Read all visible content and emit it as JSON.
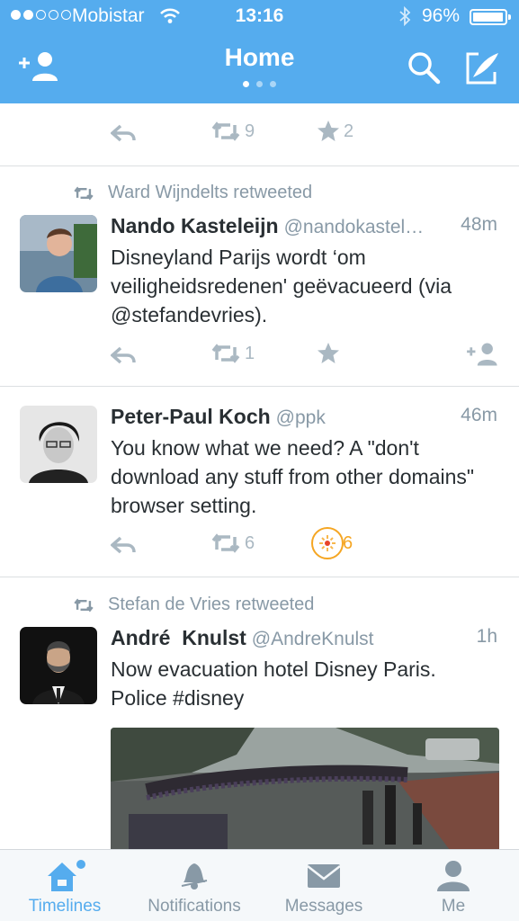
{
  "status_bar": {
    "carrier": "Mobistar",
    "time": "13:16",
    "battery": "96%",
    "battery_level": 0.96,
    "signal_bars_filled": 2,
    "signal_bars_total": 5
  },
  "header": {
    "title": "Home",
    "page_dots": 3,
    "active_dot": 0,
    "icons": [
      "add-user-icon",
      "search-icon",
      "compose-icon"
    ],
    "color": "#55acee"
  },
  "tweets": [
    {
      "partial": true,
      "actions": {
        "retweets": "9",
        "favorites": "2"
      }
    },
    {
      "retweeted_by": "Ward Wijndelts retweeted",
      "name": "Nando Kasteleijn",
      "handle": "@nandokastel…",
      "time": "48m",
      "text": "Disneyland Parijs wordt ‘om veiligheidsredenen' geëvacueerd (via @stefandevries).",
      "actions": {
        "retweets": "1",
        "favorites": ""
      }
    },
    {
      "name": "Peter-Paul Koch",
      "handle": "@ppk",
      "time": "46m",
      "text": "You know what we need? A \"don't download any stuff from other domains\" browser setting.",
      "actions": {
        "retweets": "6",
        "favorites": "6",
        "favorited": true
      }
    },
    {
      "retweeted_by": "Stefan de Vries retweeted",
      "name": "André  Knulst",
      "handle": "@AndreKnulst",
      "time": "1h",
      "text": "Now evacuation hotel Disney Paris. Police #disney",
      "has_photo": true
    }
  ],
  "tabbar": {
    "tabs": [
      {
        "label": "Timelines",
        "icon": "home-icon",
        "active": true
      },
      {
        "label": "Notifications",
        "icon": "bell-icon",
        "active": false
      },
      {
        "label": "Messages",
        "icon": "envelope-icon",
        "active": false
      },
      {
        "label": "Me",
        "icon": "person-icon",
        "active": false
      }
    ],
    "active_color": "#55acee"
  }
}
